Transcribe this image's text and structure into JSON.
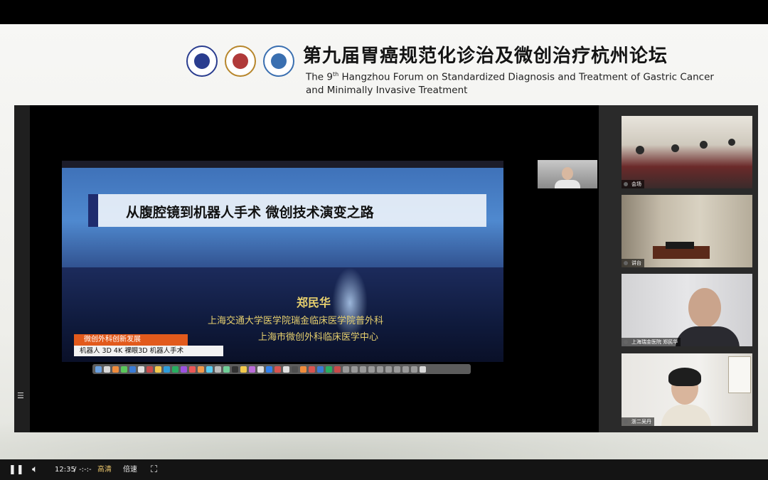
{
  "forum": {
    "title": "第九届胃癌规范化诊治及微创治疗杭州论坛",
    "subtitle_pre": "The 9",
    "subtitle_sup": "th",
    "subtitle_post": " Hangzhou Forum on Standardized Diagnosis and Treatment of Gastric Cancer and Minimally Invasive Treatment",
    "logos": [
      "hospital-logo",
      "hospital-logo",
      "hospital-logo"
    ]
  },
  "slide": {
    "title": "从腹腔镜到机器人手术  微创技术演变之路",
    "speaker": "郑民华",
    "affiliation_1": "上海交通大学医学院瑞金临床医学院普外科",
    "affiliation_2": "上海市微创外科临床医学中心",
    "tag_orange": "微创外科创新发展",
    "tag_white": "机器人 3D 4K 裸眼3D 机器人手术"
  },
  "participants": [
    {
      "label": "会场"
    },
    {
      "label": "讲台"
    },
    {
      "label": "上海瑞金医院 郑民华"
    },
    {
      "label": "浙二吴丹"
    }
  ],
  "player": {
    "play_icon": "pause-icon",
    "volume_icon": "volume-icon",
    "time": "12:35",
    "separator": "/",
    "duration": "-:-:-",
    "quality": "高清",
    "speed": "倍速",
    "fullscreen_icon": "fullscreen-icon"
  },
  "colors": {
    "accent_gold": "#e6cf6e",
    "tag_orange": "#e25a1c",
    "player_quality": "#e8c36a"
  }
}
